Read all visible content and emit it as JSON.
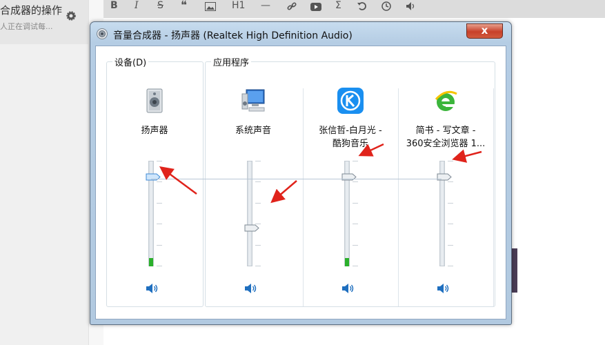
{
  "editor": {
    "note_title": "合成器的操作",
    "note_subtitle": "人正在调试每...",
    "toolbar": [
      "B",
      "I",
      "S",
      "❝",
      "image",
      "H1",
      "—",
      "link",
      "video",
      "Σ",
      "undo",
      "history",
      "audio"
    ]
  },
  "window": {
    "title": "音量合成器 - 扬声器 (Realtek High Definition Audio)",
    "close_label": "x"
  },
  "device_group": {
    "label": "设备(D)",
    "channels": [
      {
        "label_lines": [
          "扬声器"
        ],
        "icon": "speaker-icon",
        "volume": 0.9,
        "peak": 0.08,
        "muted": false
      }
    ]
  },
  "apps_group": {
    "label": "应用程序",
    "channels": [
      {
        "label_lines": [
          "系统声音"
        ],
        "icon": "system-sounds-icon",
        "volume": 0.38,
        "peak": 0.0,
        "muted": false
      },
      {
        "label_lines": [
          "张信哲-白月光 -",
          "酷狗音乐"
        ],
        "icon": "kugou-icon",
        "volume": 0.9,
        "peak": 0.08,
        "muted": false
      },
      {
        "label_lines": [
          "简书 - 写文章 -",
          "360安全浏览器 1..."
        ],
        "icon": "ie-browser-icon",
        "volume": 0.9,
        "peak": 0.0,
        "muted": false
      }
    ]
  },
  "colors": {
    "accent_level": "#2bb02b",
    "kugou_blue": "#1a8ff0",
    "annotation_red": "#e0231b"
  }
}
